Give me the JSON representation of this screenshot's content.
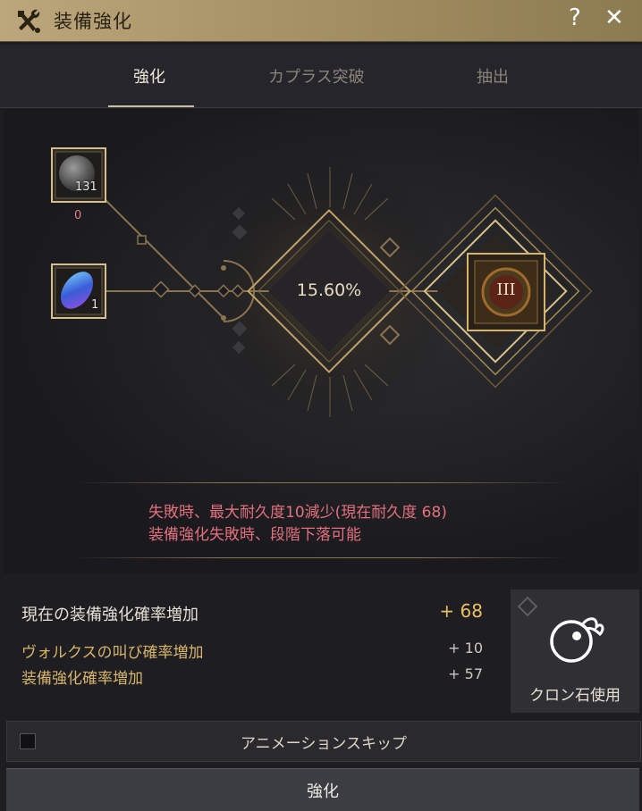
{
  "window": {
    "title": "装備強化",
    "help_label": "?",
    "close_label": "✕"
  },
  "tabs": [
    {
      "label": "強化",
      "active": true
    },
    {
      "label": "カプラス突破",
      "active": false
    },
    {
      "label": "抽出",
      "active": false
    }
  ],
  "materials": {
    "stone": {
      "icon": "black-stone-icon",
      "count": "131",
      "sub": "0"
    },
    "gem": {
      "icon": "blue-crystal-icon",
      "count": "1"
    }
  },
  "chance": "15.60%",
  "result_icon": {
    "icon": "enhancement-grade-icon",
    "grade": "III"
  },
  "warnings": {
    "line1": "失敗時、最大耐久度10減少(現在耐久度 68)",
    "line2": "装備強化失敗時、段階下落可能"
  },
  "stats": {
    "total_label": "現在の装備強化確率増加",
    "total_value": "+ 68",
    "vorx_label": "ヴォルクスの叫び確率増加",
    "vorx_value": "+ 10",
    "failstack_label": "装備強化確率増加",
    "failstack_value": "+ 57"
  },
  "cron": {
    "label": "クロン石使用",
    "icon": "cron-stone-icon"
  },
  "skip": {
    "label": "アニメーションスキップ",
    "checked": false
  },
  "enhance_button": {
    "label": "強化"
  },
  "colors": {
    "titlebar": "#bba77b",
    "gold": "#d6b46a",
    "warning": "#e4707e",
    "accent_value": "#e8c060"
  }
}
